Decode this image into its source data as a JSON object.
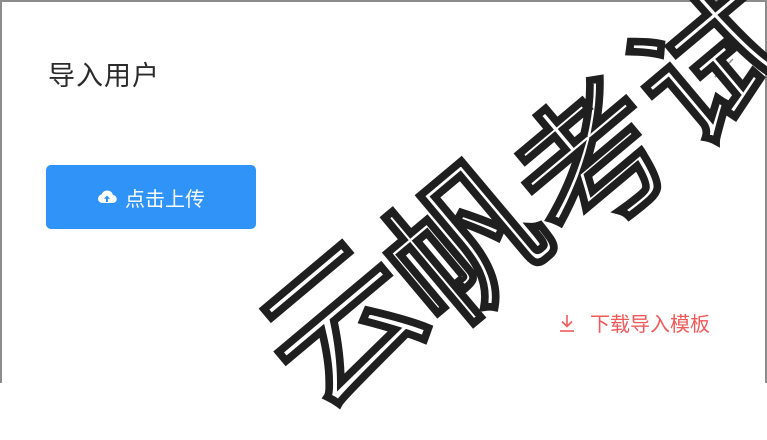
{
  "dialog": {
    "title": "导入用户",
    "close_icon": "close-icon"
  },
  "upload": {
    "button_label": "点击上传",
    "icon": "cloud-upload-icon",
    "button_color": "#2f93f8"
  },
  "download": {
    "link_label": "下载导入模板",
    "icon": "download-icon",
    "link_color": "#f25a5a"
  },
  "watermark": {
    "chars": [
      "云",
      "帆",
      "考",
      "试"
    ]
  }
}
